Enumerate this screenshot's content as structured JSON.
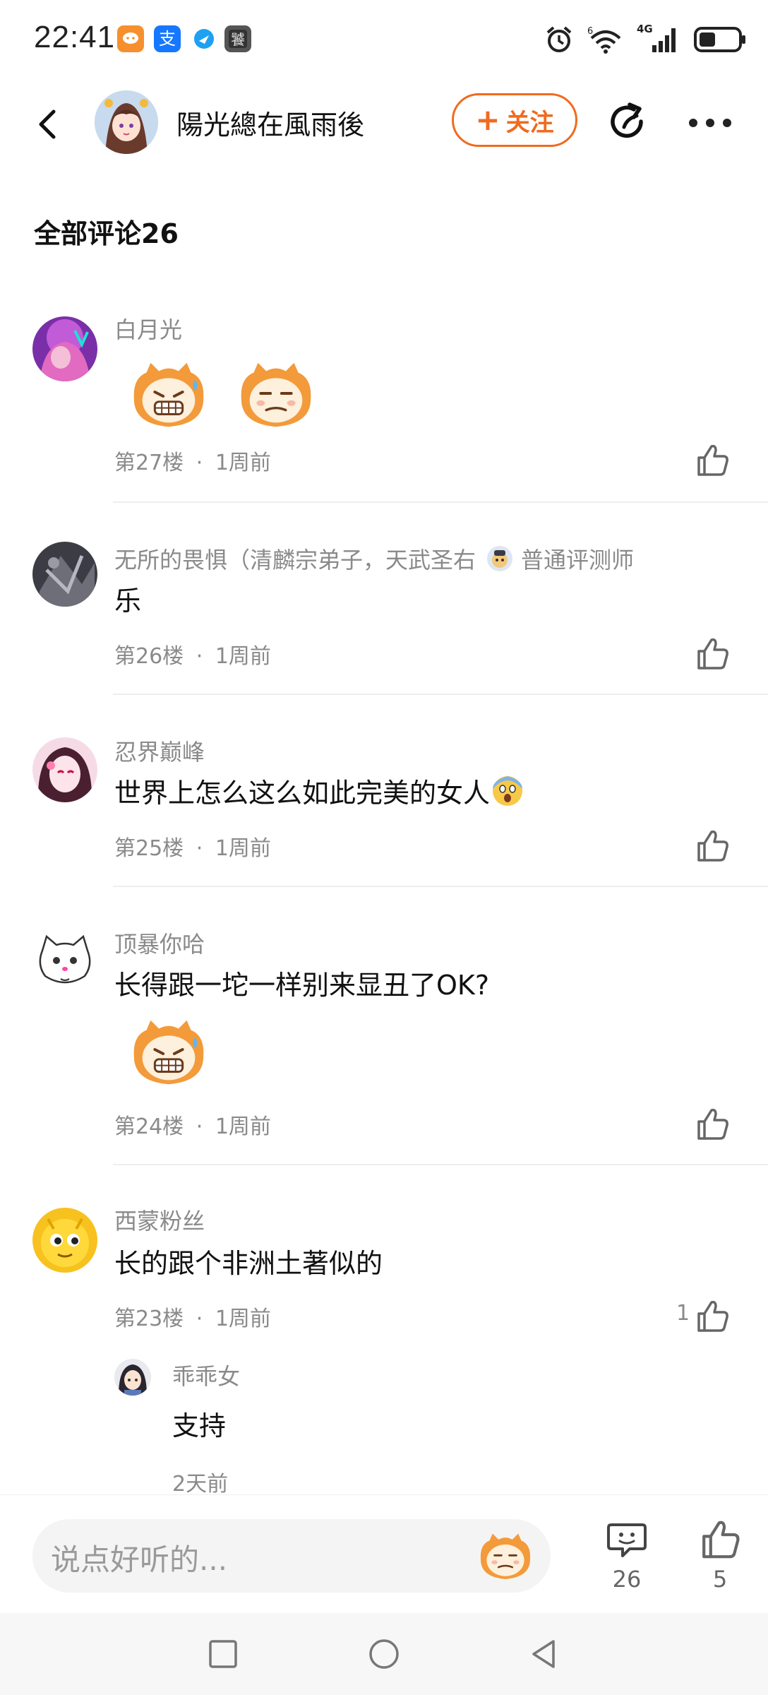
{
  "status_bar": {
    "time": "22:41",
    "network_label": "4G"
  },
  "header": {
    "author_name": "陽光總在風雨後",
    "follow_label": "关注",
    "follow_plus": "+"
  },
  "comments_section": {
    "title": "全部评论26"
  },
  "comments": [
    {
      "name": "白月光",
      "text": "",
      "floor": "第27楼",
      "time": "1周前",
      "likes": ""
    },
    {
      "name": "无所的畏惧（清麟宗弟子，天武圣右",
      "badge": "普通评测师",
      "text": "乐",
      "floor": "第26楼",
      "time": "1周前",
      "likes": ""
    },
    {
      "name": "忍界巅峰",
      "text": "世界上怎么这么如此完美的女人",
      "floor": "第25楼",
      "time": "1周前",
      "likes": ""
    },
    {
      "name": "顶暴你哈",
      "text": "长得跟一坨一样别来显丑了OK?",
      "floor": "第24楼",
      "time": "1周前",
      "likes": ""
    },
    {
      "name": "西蒙粉丝",
      "text": "长的跟个非洲土著似的",
      "floor": "第23楼",
      "time": "1周前",
      "likes": "1"
    }
  ],
  "reply": {
    "name": "乖乖女",
    "text": "支持",
    "time": "2天前"
  },
  "meta_separator": "·",
  "bottom_bar": {
    "placeholder": "说点好听的...",
    "comment_count": "26",
    "like_count": "5"
  },
  "colors": {
    "accent": "#f06b1e",
    "muted_text": "#8a8a8a",
    "divider": "#eeeeee"
  }
}
